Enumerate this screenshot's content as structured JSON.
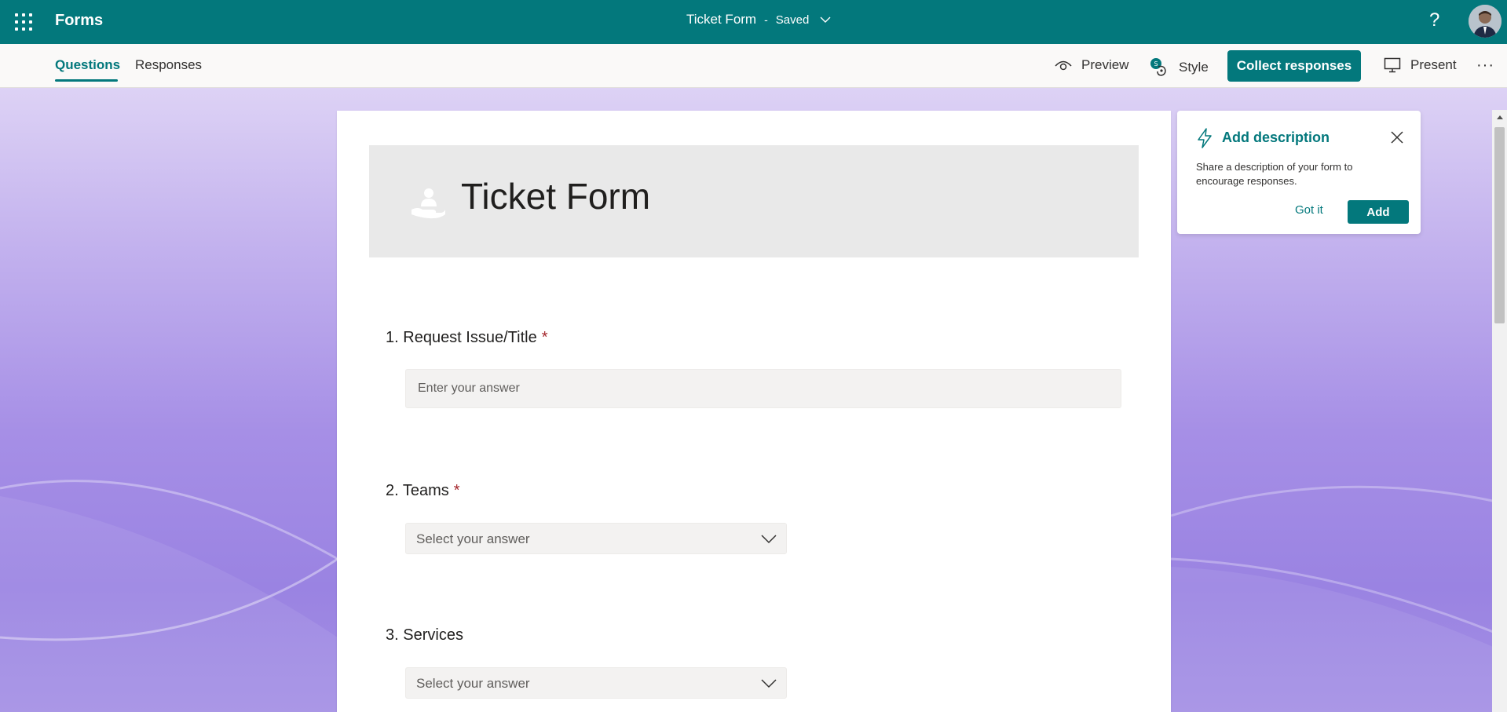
{
  "app": {
    "name": "Forms",
    "document_title": "Ticket Form",
    "separator": "-",
    "save_status": "Saved",
    "help_label": "?"
  },
  "tabs": [
    {
      "label": "Questions",
      "active": true
    },
    {
      "label": "Responses",
      "active": false
    }
  ],
  "commands": {
    "preview": "Preview",
    "style": "Style",
    "collect": "Collect responses",
    "present": "Present",
    "more": "···"
  },
  "form": {
    "title": "Ticket Form",
    "questions": [
      {
        "number": "1.",
        "label": "Request Issue/Title",
        "required": "*",
        "type": "text",
        "placeholder": "Enter your answer"
      },
      {
        "number": "2.",
        "label": "Teams",
        "required": "*",
        "type": "select",
        "placeholder": "Select your answer"
      },
      {
        "number": "3.",
        "label": "Services",
        "required": "",
        "type": "select",
        "placeholder": "Select your answer"
      }
    ]
  },
  "callout": {
    "title": "Add description",
    "text": "Share a description of your form to encourage responses.",
    "dismiss": "Got it",
    "action": "Add"
  },
  "colors": {
    "accent": "#03787c",
    "required": "#a4262c"
  },
  "icons": {
    "waffle": "waffle-icon",
    "help": "help-icon",
    "preview": "eye-icon",
    "style": "palette-icon",
    "present": "monitor-icon",
    "callout": "lightning-icon",
    "close": "close-icon",
    "banner": "hand-person-icon"
  }
}
